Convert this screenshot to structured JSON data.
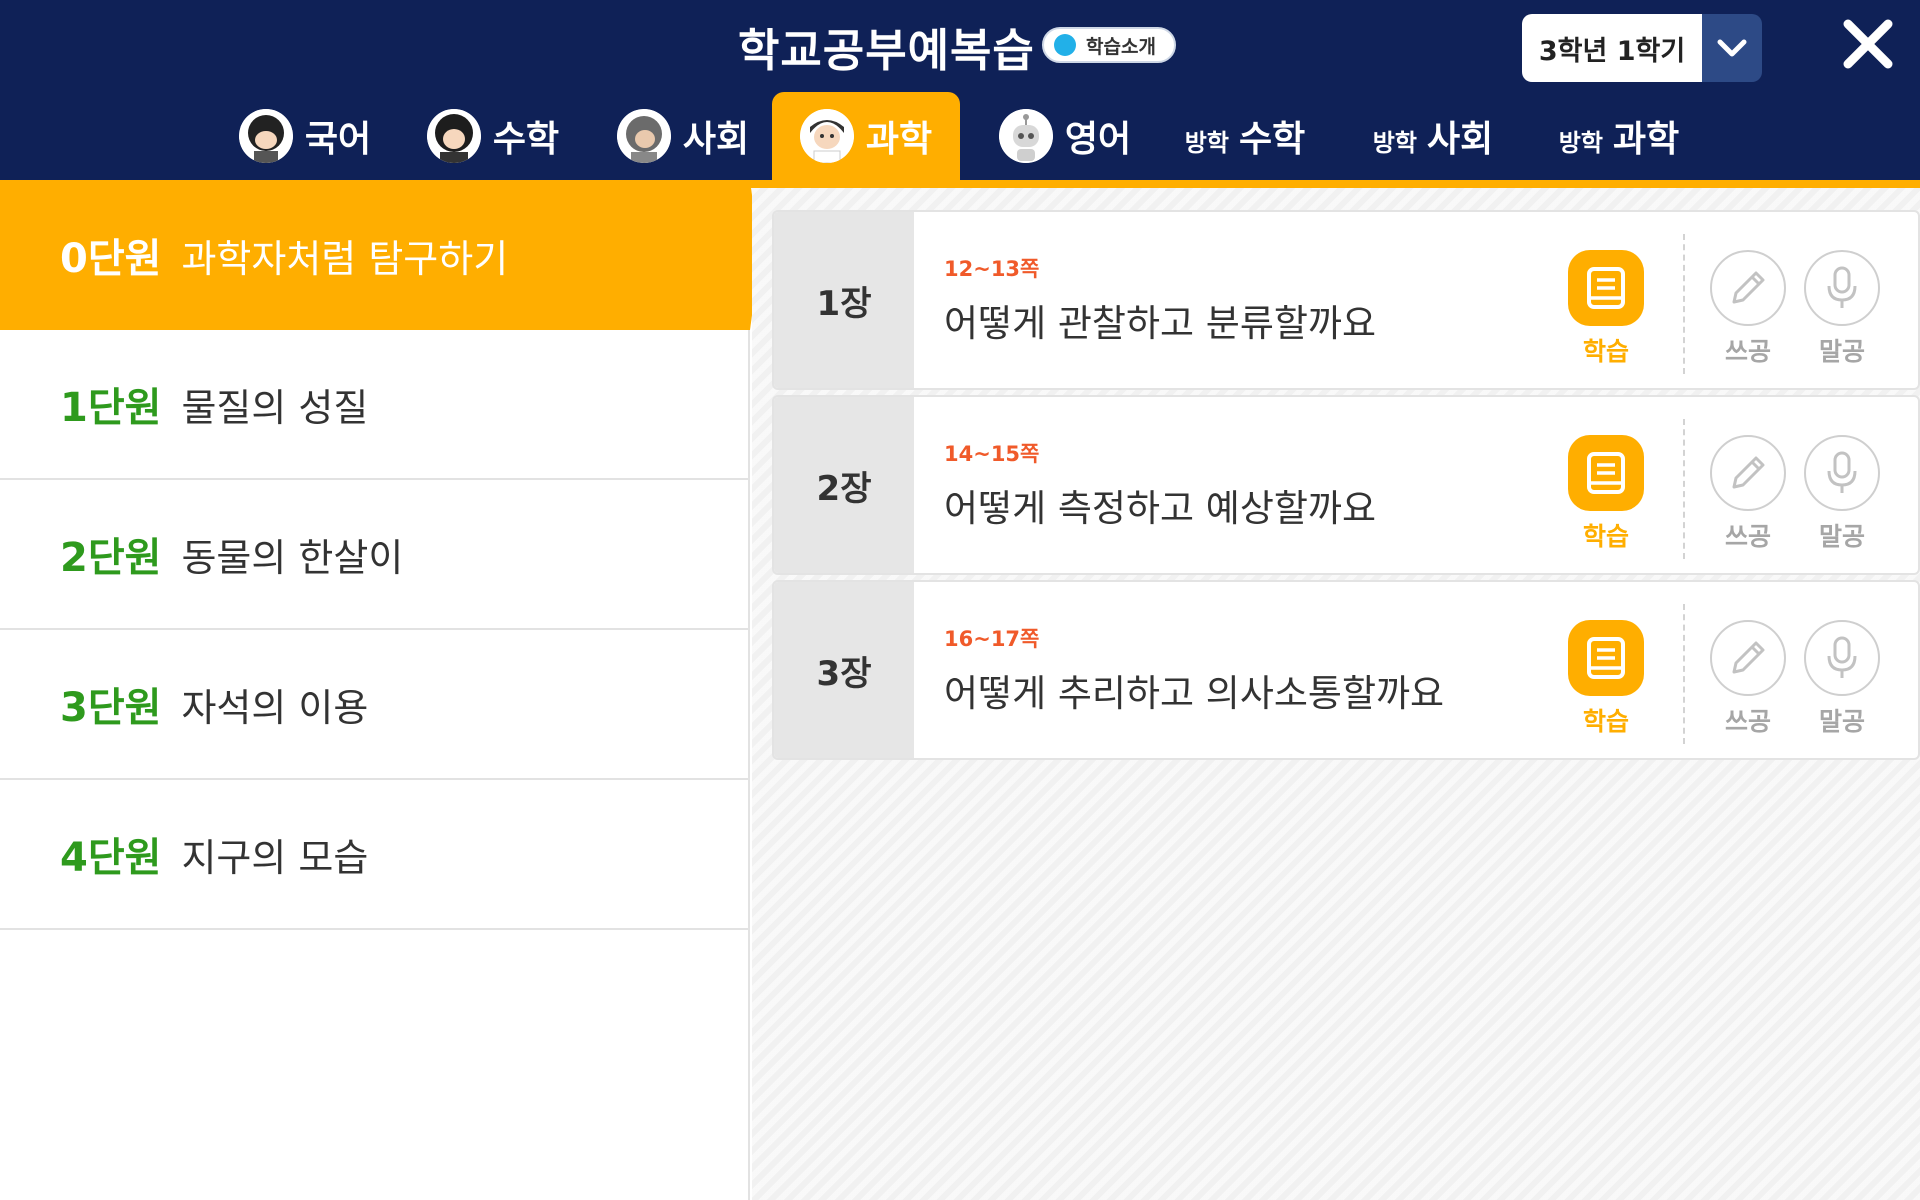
{
  "header": {
    "app_title": "학교공부예복습",
    "intro_label": "학습소개",
    "grade_label": "3학년 1학기"
  },
  "tabs": [
    {
      "label": "국어",
      "prefix": "",
      "avatar": "avatar-icon",
      "active": false
    },
    {
      "label": "수학",
      "prefix": "",
      "avatar": "avatar-icon",
      "active": false
    },
    {
      "label": "사회",
      "prefix": "",
      "avatar": "avatar-icon",
      "active": false
    },
    {
      "label": "과학",
      "prefix": "",
      "avatar": "avatar-icon",
      "active": true
    },
    {
      "label": "영어",
      "prefix": "",
      "avatar": "robot-avatar-icon",
      "active": false
    },
    {
      "label": "수학",
      "prefix": "방학",
      "avatar": "",
      "active": false
    },
    {
      "label": "사회",
      "prefix": "방학",
      "avatar": "",
      "active": false
    },
    {
      "label": "과학",
      "prefix": "방학",
      "avatar": "",
      "active": false
    }
  ],
  "units": [
    {
      "num": "0단원",
      "title": "과학자처럼 탐구하기",
      "active": true
    },
    {
      "num": "1단원",
      "title": "물질의 성질",
      "active": false
    },
    {
      "num": "2단원",
      "title": "동물의 한살이",
      "active": false
    },
    {
      "num": "3단원",
      "title": "자석의 이용",
      "active": false
    },
    {
      "num": "4단원",
      "title": "지구의 모습",
      "active": false
    }
  ],
  "chapters": [
    {
      "num": "1장",
      "pages": "12~13쪽",
      "title": "어떻게 관찰하고 분류할까요"
    },
    {
      "num": "2장",
      "pages": "14~15쪽",
      "title": "어떻게 측정하고 예상할까요"
    },
    {
      "num": "3장",
      "pages": "16~17쪽",
      "title": "어떻게 추리하고 의사소통할까요"
    }
  ],
  "actions": {
    "study": "학습",
    "write": "쓰공",
    "speak": "말공"
  },
  "colors": {
    "header_bg": "#0f2157",
    "accent": "#ffae00",
    "unit_number": "#2e9a1d",
    "page_ref": "#f05a2a"
  }
}
